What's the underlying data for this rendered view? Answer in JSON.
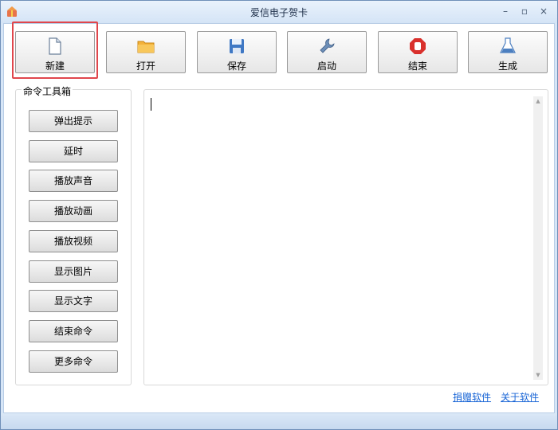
{
  "window": {
    "title": "爱信电子贺卡",
    "controls": {
      "minimize": "–",
      "maximize": "▫",
      "close": "×"
    }
  },
  "toolbar": {
    "buttons": [
      {
        "label": "新建",
        "icon": "new-file-icon"
      },
      {
        "label": "打开",
        "icon": "folder-icon"
      },
      {
        "label": "保存",
        "icon": "save-disk-icon"
      },
      {
        "label": "启动",
        "icon": "wrench-icon"
      },
      {
        "label": "结束",
        "icon": "stop-hand-icon"
      },
      {
        "label": "生成",
        "icon": "flask-icon"
      }
    ],
    "highlighted": "新建"
  },
  "toolbox": {
    "title": "命令工具箱",
    "commands": [
      "弹出提示",
      "延时",
      "播放声音",
      "播放动画",
      "播放视频",
      "显示图片",
      "显示文字",
      "结束命令",
      "更多命令"
    ]
  },
  "editor": {
    "value": ""
  },
  "footer": {
    "links": [
      "捐赠软件",
      "关于软件"
    ]
  },
  "colors": {
    "highlight_frame": "#e0464c",
    "link": "#1a66d6"
  }
}
